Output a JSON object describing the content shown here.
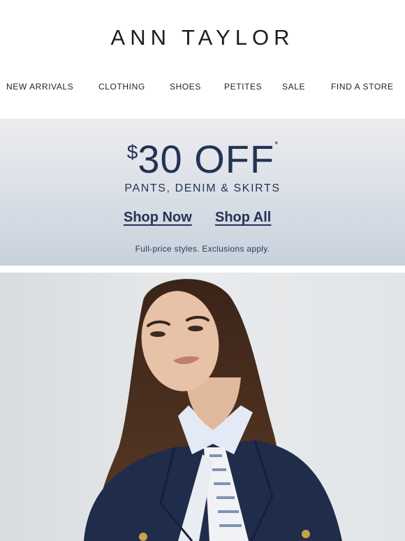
{
  "brand": {
    "logo_text": "ANN TAYLOR"
  },
  "nav": {
    "items": [
      {
        "label": "NEW ARRIVALS"
      },
      {
        "label": "CLOTHING"
      },
      {
        "label": "SHOES"
      },
      {
        "label": "PETITES"
      },
      {
        "label": "SALE"
      },
      {
        "label": "FIND A STORE"
      }
    ]
  },
  "promo": {
    "currency": "$",
    "amount": "30 OFF",
    "asterisk": "*",
    "subheading": "PANTS, DENIM & SKIRTS",
    "links": [
      {
        "label": "Shop Now"
      },
      {
        "label": "Shop All"
      }
    ],
    "fine_print": "Full-price styles. Exclusions apply."
  },
  "colors": {
    "navy": "#233354",
    "banner_top": "#ececef",
    "banner_bottom": "#c7d1dd"
  }
}
